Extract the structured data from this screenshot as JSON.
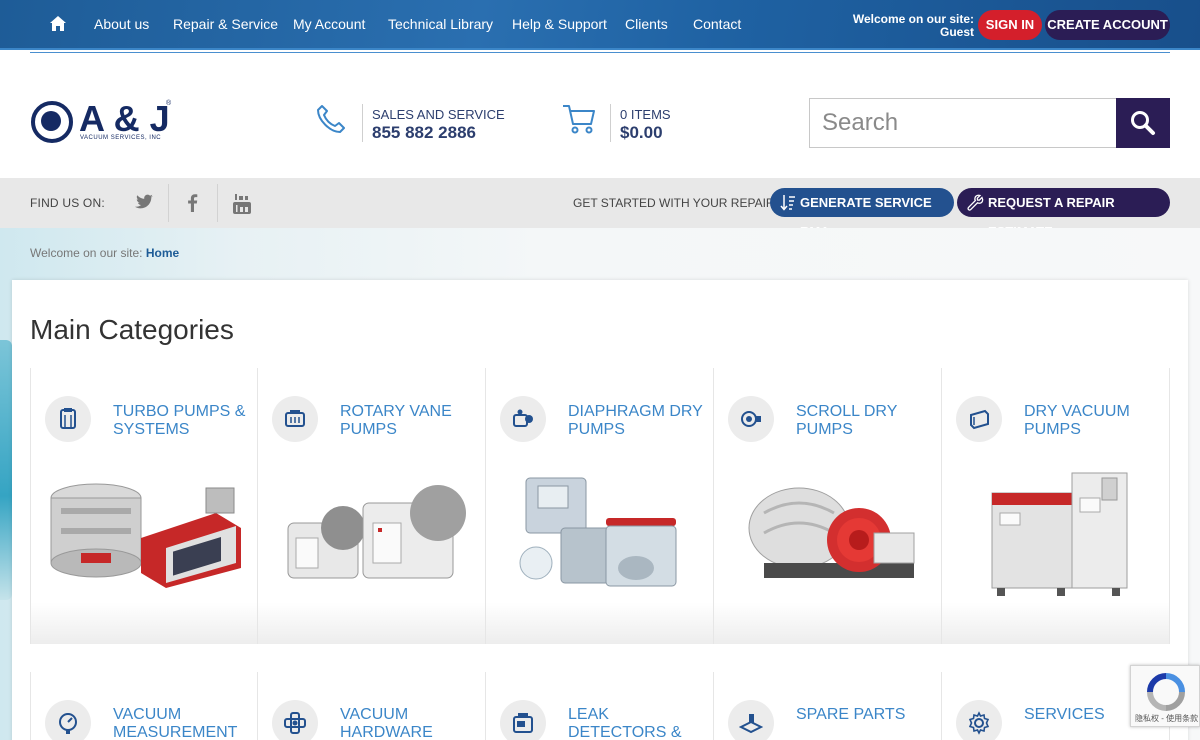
{
  "nav": {
    "items": [
      "About us",
      "Repair & Service",
      "My Account",
      "Technical Library",
      "Help & Support",
      "Clients",
      "Contact"
    ],
    "welcome_line1": "Welcome on our site:",
    "welcome_line2": "Guest",
    "sign_in": "SIGN IN",
    "create_account": "CREATE ACCOUNT"
  },
  "brand": {
    "name": "A & J",
    "subtitle": "VACUUM SERVICES, INC",
    "reg": "®"
  },
  "contact": {
    "label": "SALES AND SERVICE",
    "phone": "855 882 2886"
  },
  "cart": {
    "items": "0 ITEMS",
    "total": "$0.00"
  },
  "search": {
    "placeholder": "Search"
  },
  "findbar": {
    "label": "FIND US ON:",
    "social": [
      "twitter-icon",
      "facebook-icon",
      "youtube-icon"
    ],
    "repair_label": "GET STARTED WITH YOUR REPAIR:",
    "rma_button": "GENERATE SERVICE RMA",
    "estimate_button": "REQUEST A REPAIR ESTIMATE"
  },
  "breadcrumb": {
    "prefix": "Welcome on our site:",
    "home": "Home"
  },
  "main": {
    "title": "Main Categories",
    "categories": [
      {
        "title": "TURBO PUMPS & SYSTEMS",
        "icon": "turbo-pump-icon"
      },
      {
        "title": "ROTARY VANE PUMPS",
        "icon": "rotary-vane-icon"
      },
      {
        "title": "DIAPHRAGM DRY PUMPS",
        "icon": "diaphragm-pump-icon"
      },
      {
        "title": "SCROLL DRY PUMPS",
        "icon": "scroll-pump-icon"
      },
      {
        "title": "DRY VACUUM PUMPS",
        "icon": "dry-vacuum-icon"
      },
      {
        "title": "VACUUM MEASUREMENT",
        "icon": "gauge-icon"
      },
      {
        "title": "VACUUM HARDWARE",
        "icon": "hardware-icon"
      },
      {
        "title": "LEAK DETECTORS & MASS SPECS",
        "icon": "leak-detector-icon"
      },
      {
        "title": "SPARE PARTS",
        "icon": "spare-parts-icon"
      },
      {
        "title": "SERVICES",
        "icon": "gear-icon"
      }
    ]
  },
  "recaptcha": {
    "text": "隐私权 - 使用条款"
  },
  "colors": {
    "nav_blue": "#1f62a3",
    "accent_red": "#d41f2b",
    "deep_purple": "#2b1d55",
    "link_blue": "#3b86c8"
  }
}
